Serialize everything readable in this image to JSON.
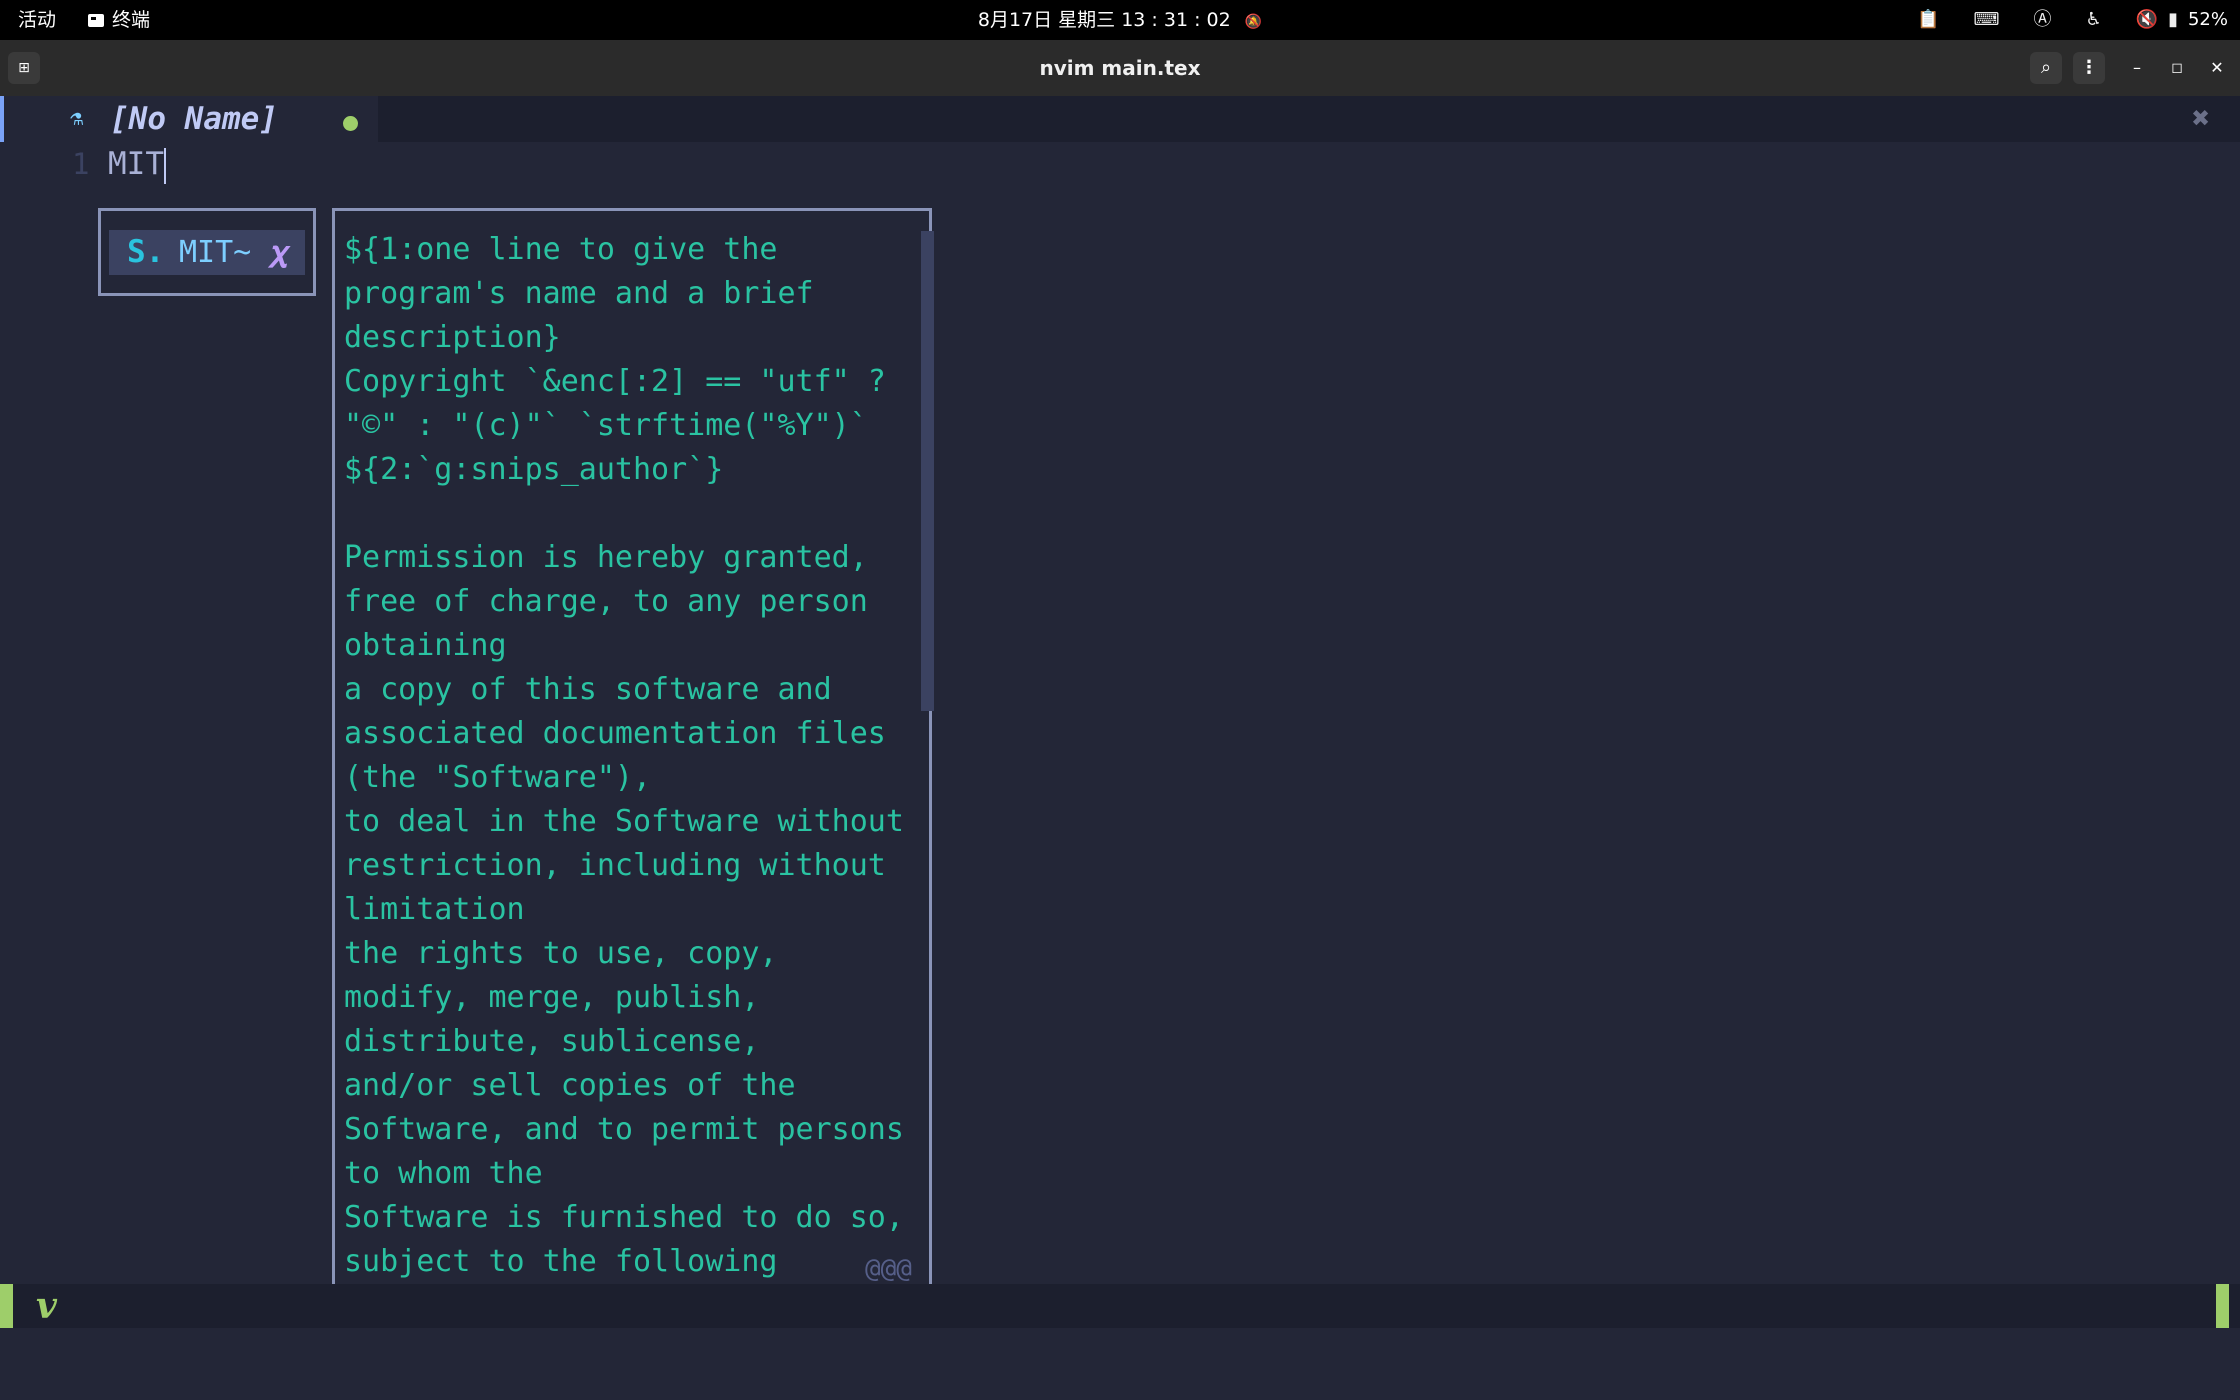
{
  "topbar": {
    "activities": "活动",
    "app_name": "终端",
    "clock": "8月17日 星期三  13 : 31 : 02",
    "battery": "52%"
  },
  "window": {
    "title": "nvim main.tex"
  },
  "editor": {
    "tab": {
      "name": "[No Name]",
      "modified": true
    },
    "lines": [
      {
        "number": "1",
        "text": "MIT"
      }
    ]
  },
  "completion": {
    "items": [
      {
        "kind": "S.",
        "word": "MIT~",
        "source": "𝝌"
      }
    ]
  },
  "documentation": {
    "text": "${1:one line to give the\nprogram's name and a brief\ndescription}\nCopyright `&enc[:2] == \"utf\" ?\n\"©\" : \"(c)\"` `strftime(\"%Y\")`\n${2:`g:snips_author`}\n\nPermission is hereby granted,\nfree of charge, to any person\nobtaining\na copy of this software and\nassociated documentation files\n(the \"Software\"),\nto deal in the Software without\nrestriction, including without\nlimitation\nthe rights to use, copy,\nmodify, merge, publish,\ndistribute, sublicense,\nand/or sell copies of the\nSoftware, and to permit persons\nto whom the\nSoftware is furnished to do so,\nsubject to the following",
    "more_indicator": "@@@"
  },
  "statusline": {
    "mode": "v"
  },
  "colors": {
    "bg": "#232637",
    "snippet_text": "#2ac3a2",
    "mode_green": "#9ece6a",
    "border": "#8a94b8"
  }
}
